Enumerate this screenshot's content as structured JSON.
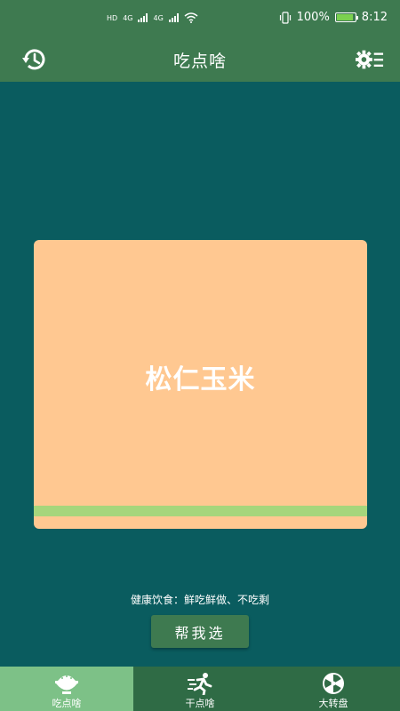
{
  "status_bar": {
    "left_labels": [
      "HD",
      "4G",
      "4G"
    ],
    "battery_percent": "100%",
    "battery_level": 0.85,
    "time": "8:12"
  },
  "header": {
    "title": "吃点啥",
    "left_icon": "history-icon",
    "right_icon": "settings-icon"
  },
  "card": {
    "food": "松仁玉米",
    "color": "#ffc891",
    "strip_color": "#a6d67c"
  },
  "slogan": "健康饮食：鲜吃鲜做、不吃剩",
  "pick_button": "帮我选",
  "bottom_nav": {
    "items": [
      {
        "label": "吃点啥",
        "icon": "rice-bowl-icon"
      },
      {
        "label": "干点啥",
        "icon": "running-icon"
      },
      {
        "label": "大转盘",
        "icon": "wheel-icon"
      }
    ]
  },
  "colors": {
    "background": "#0a5c5f",
    "bar": "#3e7a50",
    "nav_active": "#7dc187"
  }
}
